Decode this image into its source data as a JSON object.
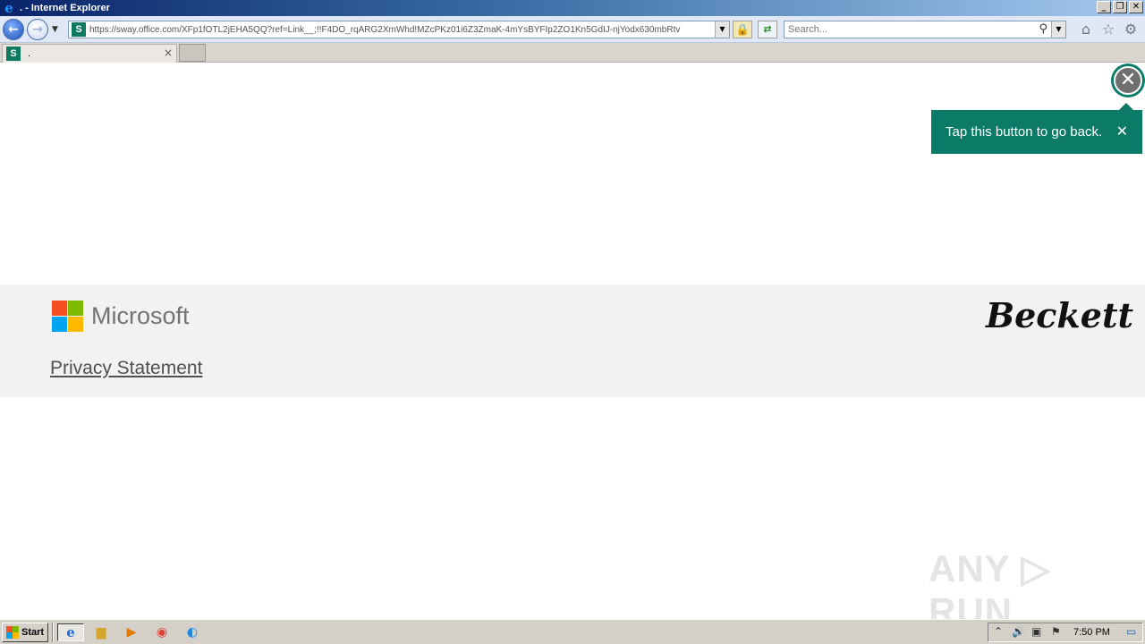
{
  "window": {
    "title": ". - Internet Explorer",
    "controls": {
      "minimize": "_",
      "restore": "❐",
      "close": "✕"
    }
  },
  "navbar": {
    "url": "https://sway.office.com/XFp1fOTL2jEHA5QQ?ref=Link__;!!F4DO_rqARG2XmWhd!MZcPKz01i6Z3ZmaK-4mYsBYFIp2ZO1Kn5GdIJ-njYodx630mbRtv",
    "search_placeholder": "Search...",
    "site_icon_letter": "S",
    "icons": [
      "back-arrow-icon",
      "forward-arrow-icon",
      "lock-icon",
      "refresh-icon",
      "magnifier-icon",
      "home-icon",
      "star-icon",
      "gear-icon"
    ]
  },
  "tabs": [
    {
      "title": ".",
      "close": "×"
    }
  ],
  "content": {
    "tooltip_text": "Tap this button to go back.",
    "tooltip_close": "✕",
    "back_close": "✕",
    "footer": {
      "ms_word": "Microsoft",
      "privacy": "Privacy Statement",
      "brand_logo": "Beckett"
    },
    "watermark": "ANY ▷ RUN"
  },
  "taskbar": {
    "start_label": "Start",
    "clock": "7:50 PM"
  },
  "colors": {
    "accent_teal": "#0b7a66",
    "title_bar": "#0a246a",
    "footer_bg": "#f2f2f2"
  }
}
